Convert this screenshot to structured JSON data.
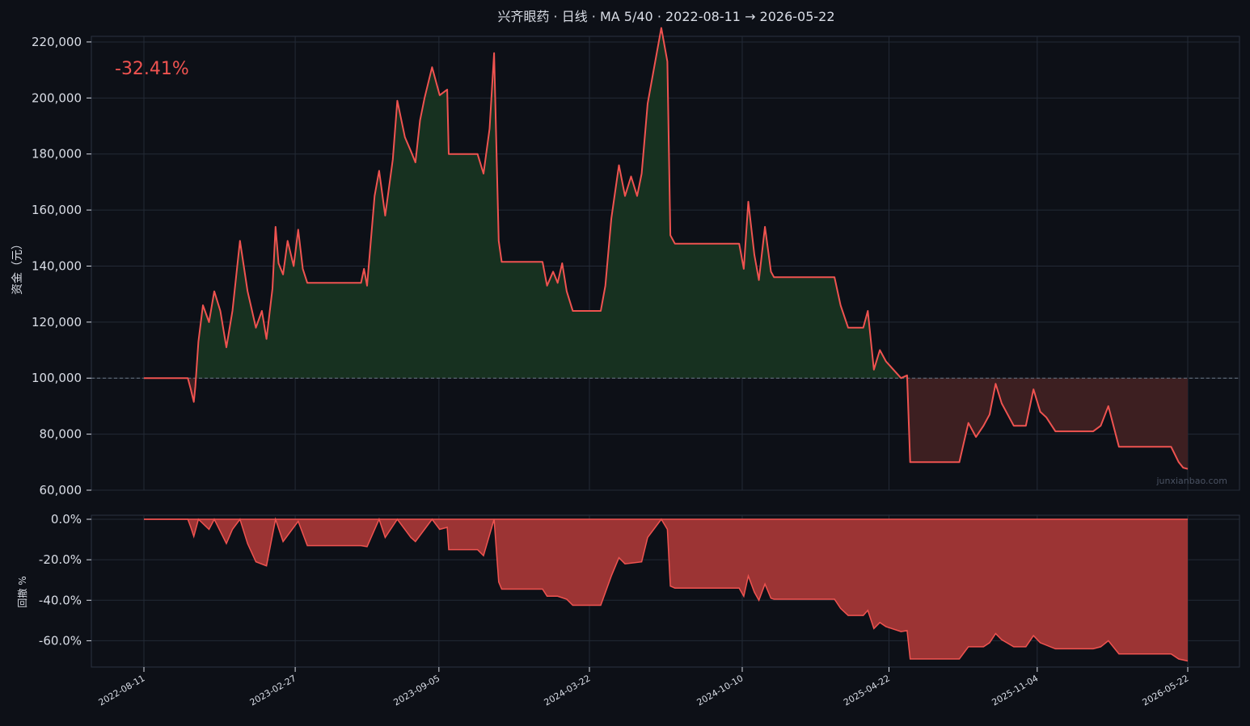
{
  "title": "兴齐眼药 · 日线 · MA 5/40 · 2022-08-11 → 2026-05-22",
  "watermark": "junxianbao.com",
  "colors": {
    "background": "#0d1017",
    "panel_bg": "#0d1017",
    "grid": "#232a36",
    "axis_text": "#d9dde6",
    "line": "#ef5350",
    "fill_above": "#173120",
    "fill_below": "#3d1f21",
    "drawdown_fill": "#9c3434",
    "baseline": "#6b7686"
  },
  "chart_data": [
    {
      "type": "line",
      "name": "equity",
      "title": "兴齐眼药 · 日线 · MA 5/40 · 2022-08-11 → 2026-05-22",
      "ylabel": "资金（元）",
      "ylim": [
        60000,
        222000
      ],
      "yticks": [
        60000,
        80000,
        100000,
        120000,
        140000,
        160000,
        180000,
        200000,
        220000
      ],
      "ytick_labels": [
        "60,000",
        "80,000",
        "100,000",
        "120,000",
        "140,000",
        "160,000",
        "180,000",
        "200,000",
        "220,000"
      ],
      "baseline": 100000,
      "annotation": "-32.41%",
      "final_return_pct": -32.41,
      "xticks": [
        "2022-08-11",
        "2023-02-27",
        "2023-09-05",
        "2024-03-22",
        "2024-10-10",
        "2025-04-22",
        "2025-11-04",
        "2026-05-22"
      ],
      "x_range": [
        "2022-08-11",
        "2026-05-22"
      ],
      "grid": true,
      "points": [
        [
          "2022-08-11",
          100000
        ],
        [
          "2022-10-08",
          100000
        ],
        [
          "2022-10-12",
          96000
        ],
        [
          "2022-10-16",
          91500
        ],
        [
          "2022-10-18",
          97000
        ],
        [
          "2022-10-22",
          113000
        ],
        [
          "2022-10-28",
          126000
        ],
        [
          "2022-11-05",
          120000
        ],
        [
          "2022-11-12",
          131000
        ],
        [
          "2022-11-20",
          124000
        ],
        [
          "2022-11-28",
          111000
        ],
        [
          "2022-12-06",
          124000
        ],
        [
          "2022-12-16",
          149000
        ],
        [
          "2022-12-26",
          131000
        ],
        [
          "2023-01-06",
          118000
        ],
        [
          "2023-01-14",
          124000
        ],
        [
          "2023-01-20",
          114000
        ],
        [
          "2023-01-28",
          132000
        ],
        [
          "2023-02-01",
          154000
        ],
        [
          "2023-02-05",
          141000
        ],
        [
          "2023-02-11",
          137000
        ],
        [
          "2023-02-17",
          149000
        ],
        [
          "2023-02-25",
          140000
        ],
        [
          "2023-03-03",
          153000
        ],
        [
          "2023-03-09",
          139000
        ],
        [
          "2023-03-15",
          134000
        ],
        [
          "2023-05-25",
          134000
        ],
        [
          "2023-05-29",
          139000
        ],
        [
          "2023-06-02",
          133000
        ],
        [
          "2023-06-12",
          165000
        ],
        [
          "2023-06-18",
          174000
        ],
        [
          "2023-06-26",
          158000
        ],
        [
          "2023-07-06",
          178000
        ],
        [
          "2023-07-12",
          199000
        ],
        [
          "2023-07-22",
          186000
        ],
        [
          "2023-07-30",
          181000
        ],
        [
          "2023-08-05",
          177000
        ],
        [
          "2023-08-11",
          192000
        ],
        [
          "2023-08-17",
          200000
        ],
        [
          "2023-08-27",
          211000
        ],
        [
          "2023-09-06",
          201000
        ],
        [
          "2023-09-16",
          203000
        ],
        [
          "2023-09-18",
          180000
        ],
        [
          "2023-10-26",
          180000
        ],
        [
          "2023-11-03",
          173000
        ],
        [
          "2023-11-11",
          189000
        ],
        [
          "2023-11-17",
          216000
        ],
        [
          "2023-11-23",
          149000
        ],
        [
          "2023-11-27",
          141500
        ],
        [
          "2024-01-20",
          141500
        ],
        [
          "2024-01-26",
          133000
        ],
        [
          "2024-02-03",
          138000
        ],
        [
          "2024-02-09",
          134000
        ],
        [
          "2024-02-15",
          141000
        ],
        [
          "2024-02-21",
          131000
        ],
        [
          "2024-02-29",
          124000
        ],
        [
          "2024-04-06",
          124000
        ],
        [
          "2024-04-12",
          133000
        ],
        [
          "2024-04-20",
          157000
        ],
        [
          "2024-04-30",
          176000
        ],
        [
          "2024-05-08",
          165000
        ],
        [
          "2024-05-16",
          172000
        ],
        [
          "2024-05-24",
          165000
        ],
        [
          "2024-05-30",
          173000
        ],
        [
          "2024-06-07",
          198000
        ],
        [
          "2024-06-15",
          210000
        ],
        [
          "2024-06-25",
          225000
        ],
        [
          "2024-07-03",
          213000
        ],
        [
          "2024-07-07",
          151000
        ],
        [
          "2024-07-13",
          148000
        ],
        [
          "2024-10-06",
          148000
        ],
        [
          "2024-10-12",
          139000
        ],
        [
          "2024-10-18",
          163000
        ],
        [
          "2024-10-26",
          144000
        ],
        [
          "2024-11-01",
          135000
        ],
        [
          "2024-11-09",
          154000
        ],
        [
          "2024-11-17",
          138000
        ],
        [
          "2024-11-21",
          136000
        ],
        [
          "2025-02-09",
          136000
        ],
        [
          "2025-02-17",
          126000
        ],
        [
          "2025-02-27",
          118000
        ],
        [
          "2025-03-19",
          118000
        ],
        [
          "2025-03-25",
          124000
        ],
        [
          "2025-04-02",
          103000
        ],
        [
          "2025-04-10",
          110000
        ],
        [
          "2025-04-18",
          106000
        ],
        [
          "2025-05-08",
          100000
        ],
        [
          "2025-05-16",
          101000
        ],
        [
          "2025-05-20",
          70000
        ],
        [
          "2025-07-24",
          70000
        ],
        [
          "2025-08-05",
          84000
        ],
        [
          "2025-08-15",
          79000
        ],
        [
          "2025-08-25",
          83000
        ],
        [
          "2025-09-02",
          87000
        ],
        [
          "2025-09-10",
          98000
        ],
        [
          "2025-09-18",
          91000
        ],
        [
          "2025-10-04",
          83000
        ],
        [
          "2025-10-20",
          83000
        ],
        [
          "2025-10-30",
          96000
        ],
        [
          "2025-11-08",
          88000
        ],
        [
          "2025-11-16",
          86000
        ],
        [
          "2025-11-28",
          81000
        ],
        [
          "2026-01-17",
          81000
        ],
        [
          "2026-01-27",
          83000
        ],
        [
          "2026-02-06",
          90000
        ],
        [
          "2026-02-20",
          75500
        ],
        [
          "2026-04-30",
          75500
        ],
        [
          "2026-05-10",
          70000
        ],
        [
          "2026-05-16",
          68000
        ],
        [
          "2026-05-22",
          67600
        ]
      ]
    },
    {
      "type": "area",
      "name": "drawdown",
      "ylabel": "回撤 %",
      "ylim": [
        -73,
        2
      ],
      "yticks": [
        0,
        -20,
        -40,
        -60
      ],
      "ytick_labels": [
        "0.0%",
        "-20.0%",
        "-40.0%",
        "-60.0%"
      ],
      "xticks": [
        "2022-08-11",
        "2023-02-27",
        "2023-09-05",
        "2024-03-22",
        "2024-10-10",
        "2025-04-22",
        "2025-11-04",
        "2026-05-22"
      ],
      "grid": true,
      "points": [
        [
          "2022-08-11",
          0
        ],
        [
          "2022-10-08",
          0
        ],
        [
          "2022-10-12",
          -4
        ],
        [
          "2022-10-16",
          -8.5
        ],
        [
          "2022-10-22",
          0
        ],
        [
          "2022-11-05",
          -5
        ],
        [
          "2022-11-12",
          0
        ],
        [
          "2022-11-28",
          -12
        ],
        [
          "2022-12-06",
          -5
        ],
        [
          "2022-12-16",
          0
        ],
        [
          "2022-12-26",
          -12
        ],
        [
          "2023-01-06",
          -21
        ],
        [
          "2023-01-20",
          -23
        ],
        [
          "2023-02-01",
          0
        ],
        [
          "2023-02-11",
          -11
        ],
        [
          "2023-03-03",
          -1
        ],
        [
          "2023-03-15",
          -13
        ],
        [
          "2023-05-25",
          -13
        ],
        [
          "2023-06-02",
          -13.5
        ],
        [
          "2023-06-18",
          0
        ],
        [
          "2023-06-26",
          -9
        ],
        [
          "2023-07-12",
          0
        ],
        [
          "2023-07-30",
          -9
        ],
        [
          "2023-08-05",
          -11
        ],
        [
          "2023-08-27",
          0
        ],
        [
          "2023-09-06",
          -5
        ],
        [
          "2023-09-16",
          -4
        ],
        [
          "2023-09-18",
          -15
        ],
        [
          "2023-10-26",
          -15
        ],
        [
          "2023-11-03",
          -18
        ],
        [
          "2023-11-17",
          0
        ],
        [
          "2023-11-23",
          -31
        ],
        [
          "2023-11-27",
          -34.5
        ],
        [
          "2024-01-20",
          -34.5
        ],
        [
          "2024-01-26",
          -38
        ],
        [
          "2024-02-09",
          -38
        ],
        [
          "2024-02-21",
          -39.5
        ],
        [
          "2024-02-29",
          -42.5
        ],
        [
          "2024-04-06",
          -42.5
        ],
        [
          "2024-04-20",
          -28
        ],
        [
          "2024-04-30",
          -19
        ],
        [
          "2024-05-08",
          -22
        ],
        [
          "2024-05-30",
          -21
        ],
        [
          "2024-06-07",
          -9
        ],
        [
          "2024-06-25",
          0
        ],
        [
          "2024-07-03",
          -5
        ],
        [
          "2024-07-07",
          -33
        ],
        [
          "2024-07-13",
          -34
        ],
        [
          "2024-10-06",
          -34
        ],
        [
          "2024-10-12",
          -38
        ],
        [
          "2024-10-18",
          -28
        ],
        [
          "2024-10-26",
          -36
        ],
        [
          "2024-11-01",
          -40
        ],
        [
          "2024-11-09",
          -32
        ],
        [
          "2024-11-17",
          -39
        ],
        [
          "2024-11-21",
          -39.5
        ],
        [
          "2025-02-09",
          -39.5
        ],
        [
          "2025-02-17",
          -44
        ],
        [
          "2025-02-27",
          -47.5
        ],
        [
          "2025-03-19",
          -47.5
        ],
        [
          "2025-03-25",
          -45
        ],
        [
          "2025-04-02",
          -54
        ],
        [
          "2025-04-10",
          -51
        ],
        [
          "2025-04-18",
          -53
        ],
        [
          "2025-05-08",
          -55.5
        ],
        [
          "2025-05-16",
          -55
        ],
        [
          "2025-05-20",
          -69
        ],
        [
          "2025-07-24",
          -69
        ],
        [
          "2025-08-05",
          -63
        ],
        [
          "2025-08-25",
          -63
        ],
        [
          "2025-09-02",
          -61
        ],
        [
          "2025-09-10",
          -56.5
        ],
        [
          "2025-09-18",
          -59.5
        ],
        [
          "2025-10-04",
          -63
        ],
        [
          "2025-10-20",
          -63
        ],
        [
          "2025-10-30",
          -57.5
        ],
        [
          "2025-11-08",
          -61
        ],
        [
          "2025-11-28",
          -64
        ],
        [
          "2026-01-17",
          -64
        ],
        [
          "2026-01-27",
          -63
        ],
        [
          "2026-02-06",
          -60
        ],
        [
          "2026-02-20",
          -66.5
        ],
        [
          "2026-04-30",
          -66.5
        ],
        [
          "2026-05-10",
          -69
        ],
        [
          "2026-05-22",
          -70
        ]
      ]
    }
  ]
}
